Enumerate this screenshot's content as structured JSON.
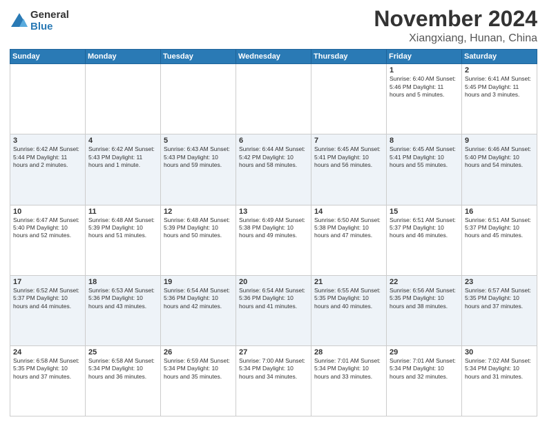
{
  "logo": {
    "general": "General",
    "blue": "Blue"
  },
  "title": "November 2024",
  "location": "Xiangxiang, Hunan, China",
  "weekdays": [
    "Sunday",
    "Monday",
    "Tuesday",
    "Wednesday",
    "Thursday",
    "Friday",
    "Saturday"
  ],
  "rows": [
    [
      {
        "day": "",
        "info": ""
      },
      {
        "day": "",
        "info": ""
      },
      {
        "day": "",
        "info": ""
      },
      {
        "day": "",
        "info": ""
      },
      {
        "day": "",
        "info": ""
      },
      {
        "day": "1",
        "info": "Sunrise: 6:40 AM\nSunset: 5:46 PM\nDaylight: 11 hours and 5 minutes."
      },
      {
        "day": "2",
        "info": "Sunrise: 6:41 AM\nSunset: 5:45 PM\nDaylight: 11 hours and 3 minutes."
      }
    ],
    [
      {
        "day": "3",
        "info": "Sunrise: 6:42 AM\nSunset: 5:44 PM\nDaylight: 11 hours and 2 minutes."
      },
      {
        "day": "4",
        "info": "Sunrise: 6:42 AM\nSunset: 5:43 PM\nDaylight: 11 hours and 1 minute."
      },
      {
        "day": "5",
        "info": "Sunrise: 6:43 AM\nSunset: 5:43 PM\nDaylight: 10 hours and 59 minutes."
      },
      {
        "day": "6",
        "info": "Sunrise: 6:44 AM\nSunset: 5:42 PM\nDaylight: 10 hours and 58 minutes."
      },
      {
        "day": "7",
        "info": "Sunrise: 6:45 AM\nSunset: 5:41 PM\nDaylight: 10 hours and 56 minutes."
      },
      {
        "day": "8",
        "info": "Sunrise: 6:45 AM\nSunset: 5:41 PM\nDaylight: 10 hours and 55 minutes."
      },
      {
        "day": "9",
        "info": "Sunrise: 6:46 AM\nSunset: 5:40 PM\nDaylight: 10 hours and 54 minutes."
      }
    ],
    [
      {
        "day": "10",
        "info": "Sunrise: 6:47 AM\nSunset: 5:40 PM\nDaylight: 10 hours and 52 minutes."
      },
      {
        "day": "11",
        "info": "Sunrise: 6:48 AM\nSunset: 5:39 PM\nDaylight: 10 hours and 51 minutes."
      },
      {
        "day": "12",
        "info": "Sunrise: 6:48 AM\nSunset: 5:39 PM\nDaylight: 10 hours and 50 minutes."
      },
      {
        "day": "13",
        "info": "Sunrise: 6:49 AM\nSunset: 5:38 PM\nDaylight: 10 hours and 49 minutes."
      },
      {
        "day": "14",
        "info": "Sunrise: 6:50 AM\nSunset: 5:38 PM\nDaylight: 10 hours and 47 minutes."
      },
      {
        "day": "15",
        "info": "Sunrise: 6:51 AM\nSunset: 5:37 PM\nDaylight: 10 hours and 46 minutes."
      },
      {
        "day": "16",
        "info": "Sunrise: 6:51 AM\nSunset: 5:37 PM\nDaylight: 10 hours and 45 minutes."
      }
    ],
    [
      {
        "day": "17",
        "info": "Sunrise: 6:52 AM\nSunset: 5:37 PM\nDaylight: 10 hours and 44 minutes."
      },
      {
        "day": "18",
        "info": "Sunrise: 6:53 AM\nSunset: 5:36 PM\nDaylight: 10 hours and 43 minutes."
      },
      {
        "day": "19",
        "info": "Sunrise: 6:54 AM\nSunset: 5:36 PM\nDaylight: 10 hours and 42 minutes."
      },
      {
        "day": "20",
        "info": "Sunrise: 6:54 AM\nSunset: 5:36 PM\nDaylight: 10 hours and 41 minutes."
      },
      {
        "day": "21",
        "info": "Sunrise: 6:55 AM\nSunset: 5:35 PM\nDaylight: 10 hours and 40 minutes."
      },
      {
        "day": "22",
        "info": "Sunrise: 6:56 AM\nSunset: 5:35 PM\nDaylight: 10 hours and 38 minutes."
      },
      {
        "day": "23",
        "info": "Sunrise: 6:57 AM\nSunset: 5:35 PM\nDaylight: 10 hours and 37 minutes."
      }
    ],
    [
      {
        "day": "24",
        "info": "Sunrise: 6:58 AM\nSunset: 5:35 PM\nDaylight: 10 hours and 37 minutes."
      },
      {
        "day": "25",
        "info": "Sunrise: 6:58 AM\nSunset: 5:34 PM\nDaylight: 10 hours and 36 minutes."
      },
      {
        "day": "26",
        "info": "Sunrise: 6:59 AM\nSunset: 5:34 PM\nDaylight: 10 hours and 35 minutes."
      },
      {
        "day": "27",
        "info": "Sunrise: 7:00 AM\nSunset: 5:34 PM\nDaylight: 10 hours and 34 minutes."
      },
      {
        "day": "28",
        "info": "Sunrise: 7:01 AM\nSunset: 5:34 PM\nDaylight: 10 hours and 33 minutes."
      },
      {
        "day": "29",
        "info": "Sunrise: 7:01 AM\nSunset: 5:34 PM\nDaylight: 10 hours and 32 minutes."
      },
      {
        "day": "30",
        "info": "Sunrise: 7:02 AM\nSunset: 5:34 PM\nDaylight: 10 hours and 31 minutes."
      }
    ]
  ]
}
